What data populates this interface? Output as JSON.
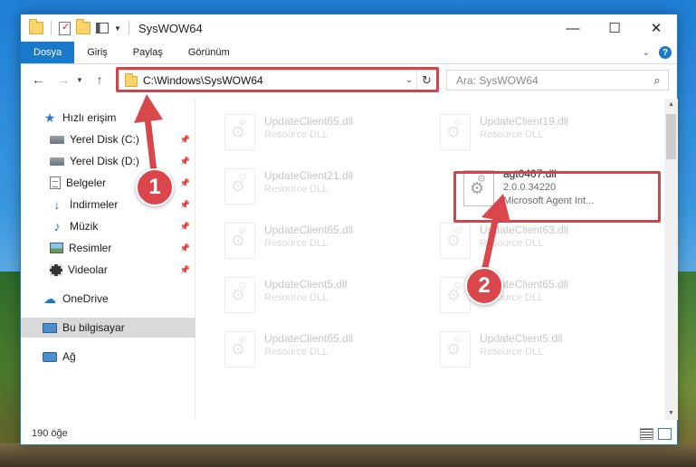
{
  "window": {
    "title": "SysWOW64",
    "controls": {
      "minimize": "—",
      "maximize": "☐",
      "close": "✕"
    },
    "accent_color": "#1979ca"
  },
  "ribbon": {
    "tabs": [
      "Dosya",
      "Giriş",
      "Paylaş",
      "Görünüm"
    ],
    "help": "?"
  },
  "address_bar": {
    "path": "C:\\Windows\\SysWOW64",
    "search_placeholder": "Ara: SysWOW64"
  },
  "sidebar": {
    "items": [
      {
        "label": "Hızlı erişim",
        "icon": "star-icon",
        "pinned": false
      },
      {
        "label": "Yerel Disk (C:)",
        "icon": "drive-icon",
        "pinned": true
      },
      {
        "label": "Yerel Disk (D:)",
        "icon": "drive-icon",
        "pinned": true
      },
      {
        "label": "Belgeler",
        "icon": "documents-icon",
        "pinned": true
      },
      {
        "label": "İndirmeler",
        "icon": "download-icon",
        "pinned": true
      },
      {
        "label": "Müzik",
        "icon": "music-icon",
        "pinned": true
      },
      {
        "label": "Resimler",
        "icon": "pictures-icon",
        "pinned": true
      },
      {
        "label": "Videolar",
        "icon": "videos-icon",
        "pinned": true
      },
      {
        "label": "OneDrive",
        "icon": "cloud-icon",
        "pinned": false
      },
      {
        "label": "Bu bilgisayar",
        "icon": "computer-icon",
        "pinned": false,
        "selected": true
      },
      {
        "label": "Ağ",
        "icon": "network-icon",
        "pinned": false
      }
    ]
  },
  "files": [
    {
      "name": "UpdateClient65.dll",
      "sub": "Resource DLL",
      "highlighted": false
    },
    {
      "name": "UpdateClient19.dll",
      "sub": "Resource DLL",
      "highlighted": false
    },
    {
      "name": "UpdateClient21.dll",
      "sub": "Resource DLL",
      "highlighted": false
    },
    {
      "name": "agt0407.dll",
      "version": "2.0.0.34220",
      "sub": "Microsoft Agent Int...",
      "highlighted": true
    },
    {
      "name": "UpdateClient65.dll",
      "sub": "Resource DLL",
      "highlighted": false
    },
    {
      "name": "UpdateClient63.dll",
      "sub": "Resource DLL",
      "highlighted": false
    },
    {
      "name": "UpdateClient5.dll",
      "sub": "Resource DLL",
      "highlighted": false
    },
    {
      "name": "UpdateClient65.dll",
      "sub": "Resource DLL",
      "highlighted": false
    },
    {
      "name": "UpdateClient65.dll",
      "sub": "Resource DLL",
      "highlighted": false
    },
    {
      "name": "UpdateClient5.dll",
      "sub": "Resource DLL",
      "highlighted": false
    }
  ],
  "status": {
    "item_count": "190 öğe"
  },
  "annotations": {
    "step1": "1",
    "step2": "2",
    "color": "#d9474d"
  }
}
